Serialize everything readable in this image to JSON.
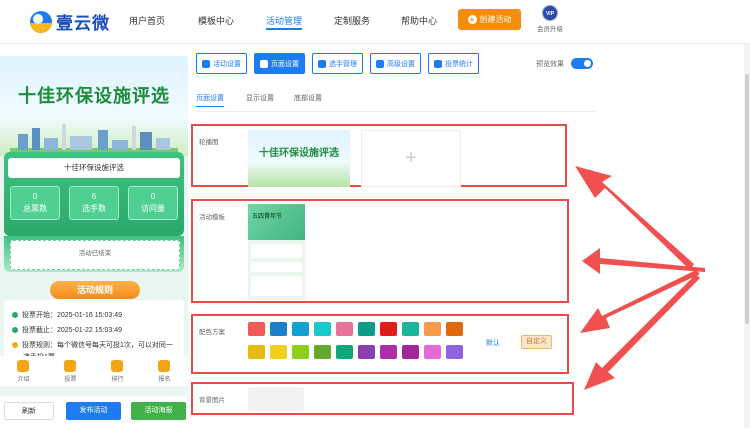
{
  "app": {
    "name": "壹云微"
  },
  "nav": {
    "items": [
      {
        "label": "用户首页"
      },
      {
        "label": "模板中心"
      },
      {
        "label": "活动管理"
      },
      {
        "label": "定制服务"
      },
      {
        "label": "帮助中心"
      }
    ]
  },
  "header": {
    "create_label": "创建活动",
    "vip_badge": "VIP",
    "vip_label": "会员升级"
  },
  "preview": {
    "hero_title": "十佳环保设施评选",
    "card_title": "十佳环保设施评选",
    "stats": [
      {
        "value": "0",
        "label": "总票数"
      },
      {
        "value": "6",
        "label": "选手数"
      },
      {
        "value": "0",
        "label": "访问量"
      }
    ],
    "ended_text": "活动已结束",
    "rules_title": "活动规则",
    "rules": [
      "投票开始：2025-01-16 15:03:49",
      "投票截止：2025-01-22 15:03:49",
      "投票规则：每个微信号每天可投1次，可以对同一",
      "选手投1票"
    ],
    "tabbar": [
      "介绍",
      "投票",
      "排行",
      "报名"
    ],
    "actions": {
      "refresh": "刷新",
      "publish": "发布活动",
      "activity_poster": "活动海报"
    }
  },
  "editor": {
    "tabs": [
      "活动设置",
      "页面设置",
      "选手管理",
      "高级设置",
      "投票统计"
    ],
    "preview_toggle_label": "预览效果",
    "subtabs": [
      "页面设置",
      "显示设置",
      "底部设置"
    ],
    "sections": {
      "carousel": "轮播图",
      "carousel_image_title": "十佳环保设施评选",
      "add_symbol": "+",
      "template": "活动模板",
      "template_text": "五四青年节",
      "colors": "配色方案",
      "default_label": "默认",
      "custom_label": "自定义",
      "background": "背景图片"
    },
    "color_palette": [
      "#f25a5a",
      "#1b7fc9",
      "#0fa2d2",
      "#1ac9c9",
      "#e8739a",
      "#0c9c8a",
      "#e51a1a",
      "#1ab59a",
      "#f79a4a",
      "#e0690c",
      "#e5b90f",
      "#f2cf1a",
      "#8ecf1a",
      "#63a92e",
      "#13a67a",
      "#8a3fb0",
      "#b02fa8",
      "#a3279a",
      "#e56ad8",
      "#9263e0"
    ]
  }
}
